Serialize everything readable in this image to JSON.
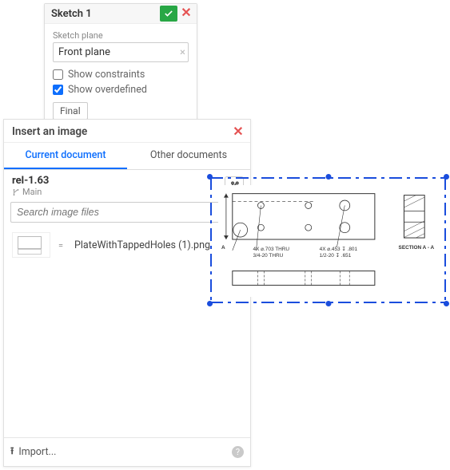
{
  "sketch_panel": {
    "title": "Sketch 1",
    "plane_label": "Sketch plane",
    "plane_value": "Front plane",
    "show_constraints_label": "Show constraints",
    "show_constraints_checked": false,
    "show_overdefined_label": "Show overdefined",
    "show_overdefined_checked": true,
    "final_label": "Final"
  },
  "insert_panel": {
    "title": "Insert an image",
    "tabs": [
      {
        "label": "Current document",
        "active": true
      },
      {
        "label": "Other documents",
        "active": false
      }
    ],
    "version": "rel-1.63",
    "branch": "Main",
    "search_placeholder": "Search image files",
    "file_kind_glyph": "=",
    "file_name": "PlateWithTappedHoles (1).png",
    "import_label": "Import..."
  },
  "drawing": {
    "callout1_line1": "4X ⌀.703 THRU",
    "callout1_line2": "3/4-20 THRU",
    "callout2_line1": "4X ⌀.453 ↧ .801",
    "callout2_line2": "1/2-20 ↧ .651",
    "section_label_left": "A",
    "section_title": "SECTION A - A"
  }
}
